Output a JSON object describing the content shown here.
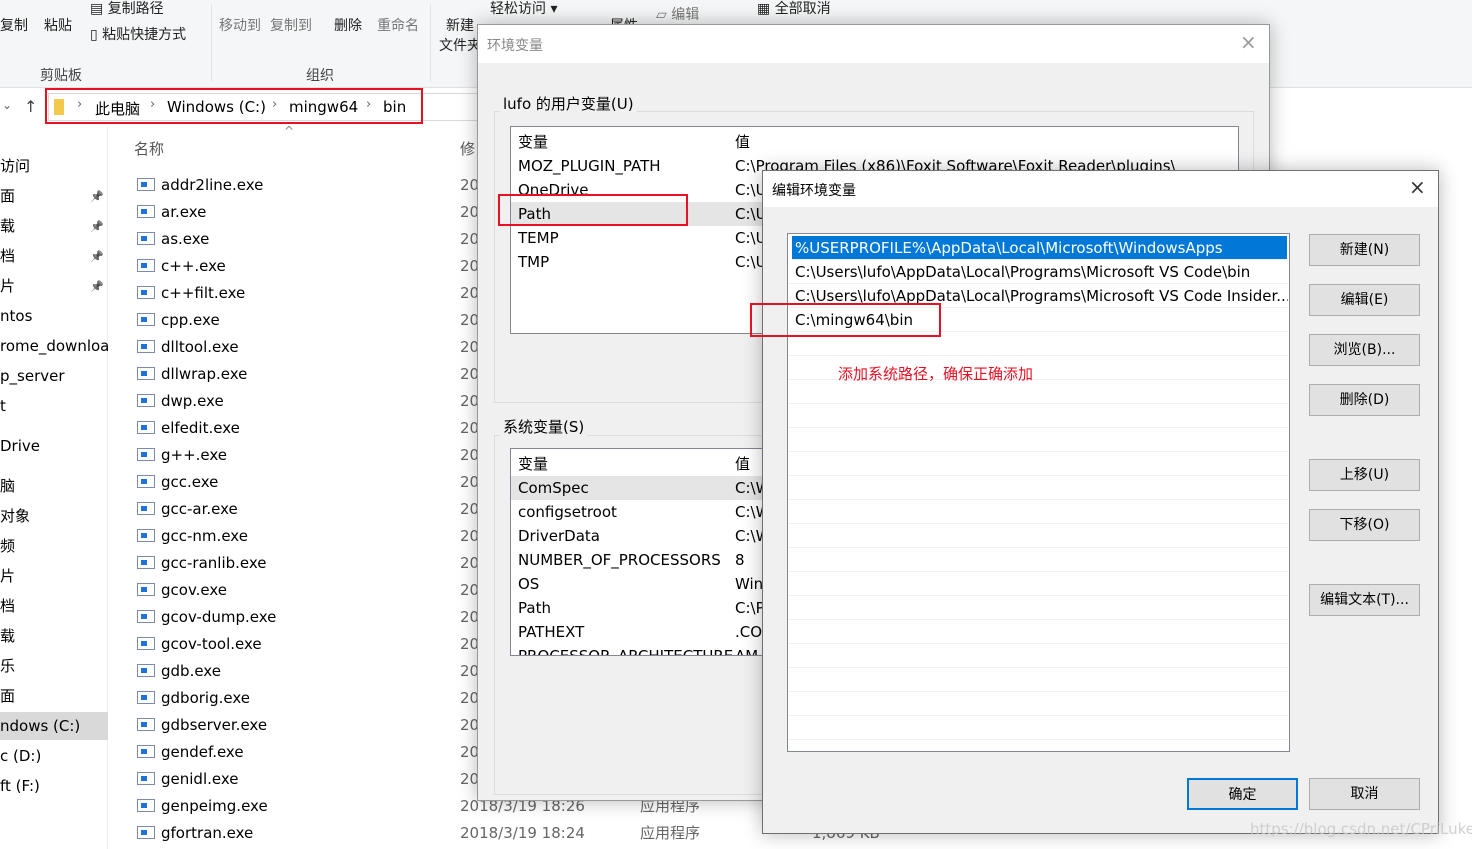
{
  "ribbon": {
    "copy": "复制",
    "paste": "粘贴",
    "copy_path": "复制路径",
    "paste_shortcut": "粘贴快捷方式",
    "move_to": "移动到",
    "copy_to": "复制到",
    "delete": "删除",
    "rename": "重命名",
    "new_folder_1": "新建",
    "new_folder_2": "文件夹",
    "easy_access": "轻松访问 ▾",
    "properties": "属性",
    "edit": "编辑",
    "select_none": "全部取消",
    "group_clipboard": "剪贴板",
    "group_organize": "组织"
  },
  "address": {
    "crumbs": [
      "此电脑",
      "Windows (C:)",
      "mingw64",
      "bin"
    ]
  },
  "sidebar": {
    "items": [
      "访问",
      "面",
      "载",
      "档",
      "片",
      "ntos",
      "rome_download",
      "p_server",
      "t",
      "Drive",
      "脑",
      "对象",
      "频",
      "片",
      "档",
      "载",
      "乐",
      "面",
      "ndows (C:)",
      "c (D:)",
      "ft (F:)"
    ]
  },
  "files": {
    "header_name": "名称",
    "header_date": "修",
    "names": [
      "addr2line.exe",
      "ar.exe",
      "as.exe",
      "c++.exe",
      "c++filt.exe",
      "cpp.exe",
      "dlltool.exe",
      "dllwrap.exe",
      "dwp.exe",
      "elfedit.exe",
      "g++.exe",
      "gcc.exe",
      "gcc-ar.exe",
      "gcc-nm.exe",
      "gcc-ranlib.exe",
      "gcov.exe",
      "gcov-dump.exe",
      "gcov-tool.exe",
      "gdb.exe",
      "gdborig.exe",
      "gdbserver.exe",
      "gendef.exe",
      "genidl.exe",
      "genpeimg.exe",
      "gfortran.exe"
    ],
    "date_partial": "20",
    "last_rows": [
      {
        "date": "2018/3/19 18:26",
        "type": "应用程序"
      },
      {
        "date": "2018/3/19 18:24",
        "type": "应用程序",
        "size": "1,869 KB"
      }
    ]
  },
  "env_dialog": {
    "title": "环境变量",
    "user_group": "lufo 的用户变量(U)",
    "col_var": "变量",
    "col_val": "值",
    "user_vars": [
      {
        "name": "MOZ_PLUGIN_PATH",
        "value": "C:\\Program Files (x86)\\Foxit Software\\Foxit Reader\\plugins\\"
      },
      {
        "name": "OneDrive",
        "value": "C:\\U"
      },
      {
        "name": "Path",
        "value": "C:\\U"
      },
      {
        "name": "TEMP",
        "value": "C:\\U"
      },
      {
        "name": "TMP",
        "value": "C:\\U"
      }
    ],
    "system_group": "系统变量(S)",
    "system_vars": [
      {
        "name": "ComSpec",
        "value": "C:\\W"
      },
      {
        "name": "configsetroot",
        "value": "C:\\W"
      },
      {
        "name": "DriverData",
        "value": "C:\\W"
      },
      {
        "name": "NUMBER_OF_PROCESSORS",
        "value": "8"
      },
      {
        "name": "OS",
        "value": "Win"
      },
      {
        "name": "Path",
        "value": "C:\\P"
      },
      {
        "name": "PATHEXT",
        "value": ".CO"
      },
      {
        "name": "PROCESSOR_ARCHITECTURE",
        "value": "AM"
      }
    ]
  },
  "edit_dialog": {
    "title": "编辑环境变量",
    "paths": [
      "%USERPROFILE%\\AppData\\Local\\Microsoft\\WindowsApps",
      "C:\\Users\\lufo\\AppData\\Local\\Programs\\Microsoft VS Code\\bin",
      "C:\\Users\\lufo\\AppData\\Local\\Programs\\Microsoft VS Code Insider...",
      "C:\\mingw64\\bin"
    ],
    "annotation": "添加系统路径，确保正确添加",
    "buttons": {
      "new": "新建(N)",
      "edit": "编辑(E)",
      "browse": "浏览(B)...",
      "delete": "删除(D)",
      "up": "上移(U)",
      "down": "下移(O)",
      "edit_text": "编辑文本(T)...",
      "ok": "确定",
      "cancel": "取消"
    }
  },
  "watermark": "https://blog.csdn.net/CPriLuke",
  "colors": {
    "selection": "#0078d7",
    "highlight_box": "#e81123",
    "annotation": "#e81123"
  }
}
